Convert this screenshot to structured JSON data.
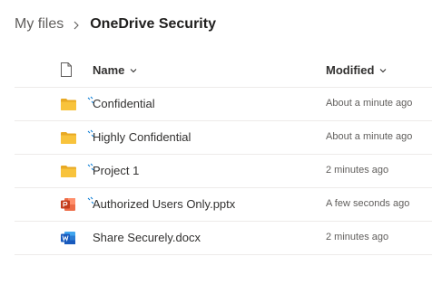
{
  "breadcrumb": {
    "root": "My files",
    "current": "OneDrive Security"
  },
  "header": {
    "name_label": "Name",
    "modified_label": "Modified"
  },
  "colors": {
    "folder": "#f8c33c",
    "folder_dark": "#e8a924",
    "powerpoint": "#c43e1c",
    "word": "#185abd",
    "sync_arrows": "#0078d4"
  },
  "files": [
    {
      "name": "Confidential",
      "modified": "About a minute ago",
      "icon": "folder-icon",
      "syncing": true
    },
    {
      "name": "Highly Confidential",
      "modified": "About a minute ago",
      "icon": "folder-icon",
      "syncing": true
    },
    {
      "name": "Project 1",
      "modified": "2 minutes ago",
      "icon": "folder-icon",
      "syncing": true
    },
    {
      "name": "Authorized Users Only.pptx",
      "modified": "A few seconds ago",
      "icon": "powerpoint-icon",
      "syncing": true
    },
    {
      "name": "Share Securely.docx",
      "modified": "2 minutes ago",
      "icon": "word-icon",
      "syncing": false
    }
  ]
}
